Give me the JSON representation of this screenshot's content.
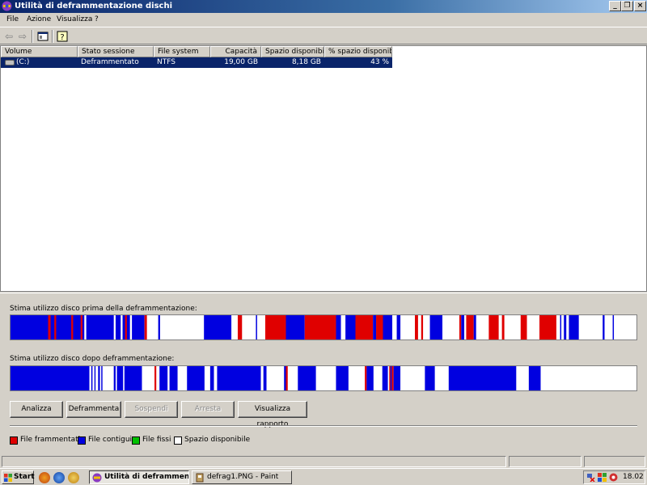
{
  "window": {
    "title": "Utilità di deframmentazione dischi",
    "controls": {
      "minimize": "_",
      "restore": "❐",
      "close": "×"
    }
  },
  "menu": [
    "File",
    "Azione",
    "Visualizza",
    "?"
  ],
  "toolbar": {
    "icons": [
      "back-arrow-icon",
      "forward-arrow-icon",
      "console-tree-icon",
      "help-icon"
    ]
  },
  "volume_list": {
    "columns": [
      "Volume",
      "Stato sessione",
      "File system",
      "Capacità",
      "Spazio disponibile",
      "% spazio disponibile"
    ],
    "rows": [
      {
        "volume": "(C:)",
        "status": "Deframmentato",
        "fs": "NTFS",
        "capacity": "19,00 GB",
        "free": "8,18 GB",
        "free_pct": "43 %"
      }
    ]
  },
  "maps": {
    "before_label": "Stima utilizzo disco prima della deframmentazione:",
    "after_label": "Stima utilizzo disco dopo deframmentazione:"
  },
  "buttons": {
    "analyze": "Analizza",
    "defrag": "Deframmenta",
    "pause": "Sospendi",
    "stop": "Arresta",
    "report": "Visualizza rapporto"
  },
  "legend": [
    {
      "label": "File frammentati",
      "color": "#e00000"
    },
    {
      "label": "File contigui",
      "color": "#0000e0"
    },
    {
      "label": "File fissi",
      "color": "#00c000"
    },
    {
      "label": "Spazio disponibile",
      "color": "#ffffff"
    }
  ],
  "colors": {
    "fragmented": "#e00000",
    "contiguous": "#0000e0",
    "free": "#ffffff",
    "selection": "#0a246a"
  },
  "taskbar": {
    "start": "Start",
    "tasks": [
      {
        "label": "Utilità di deframment...",
        "active": true
      },
      {
        "label": "defrag1.PNG - Paint",
        "active": false
      }
    ],
    "clock": "18.02"
  },
  "disk_map": {
    "before": [
      [
        "b",
        0.0,
        0.118
      ],
      [
        "f",
        0.06,
        0.064
      ],
      [
        "f",
        0.07,
        0.073
      ],
      [
        "f",
        0.097,
        0.1
      ],
      [
        "f",
        0.112,
        0.115
      ],
      [
        "w",
        0.118,
        0.121
      ],
      [
        "b",
        0.121,
        0.191
      ],
      [
        "w",
        0.165,
        0.168
      ],
      [
        "w",
        0.176,
        0.179
      ],
      [
        "f",
        0.183,
        0.186
      ],
      [
        "w",
        0.191,
        0.194
      ],
      [
        "b",
        0.194,
        0.214
      ],
      [
        "f",
        0.214,
        0.218
      ],
      [
        "w",
        0.218,
        0.234
      ],
      [
        "w",
        0.234,
        0.236
      ],
      [
        "b",
        0.236,
        0.239
      ],
      [
        "w",
        0.239,
        0.309
      ],
      [
        "b",
        0.309,
        0.353
      ],
      [
        "w",
        0.353,
        0.363
      ],
      [
        "f",
        0.363,
        0.37
      ],
      [
        "w",
        0.37,
        0.392
      ],
      [
        "b",
        0.392,
        0.394
      ],
      [
        "w",
        0.394,
        0.407
      ],
      [
        "f",
        0.407,
        0.44
      ],
      [
        "w",
        0.44,
        0.44
      ],
      [
        "b",
        0.44,
        0.47
      ],
      [
        "f",
        0.47,
        0.52
      ],
      [
        "b",
        0.52,
        0.528
      ],
      [
        "w",
        0.528,
        0.535
      ],
      [
        "b",
        0.535,
        0.551
      ],
      [
        "f",
        0.551,
        0.579
      ],
      [
        "b",
        0.579,
        0.584
      ],
      [
        "f",
        0.584,
        0.595
      ],
      [
        "b",
        0.595,
        0.61
      ],
      [
        "w",
        0.61,
        0.617
      ],
      [
        "b",
        0.617,
        0.623
      ],
      [
        "w",
        0.623,
        0.646
      ],
      [
        "f",
        0.646,
        0.651
      ],
      [
        "f",
        0.656,
        0.659
      ],
      [
        "b",
        0.67,
        0.69
      ],
      [
        "w",
        0.69,
        0.717
      ],
      [
        "f",
        0.717,
        0.72
      ],
      [
        "b",
        0.72,
        0.725
      ],
      [
        "w",
        0.725,
        0.728
      ],
      [
        "f",
        0.728,
        0.74
      ],
      [
        "b",
        0.74,
        0.744
      ],
      [
        "w",
        0.744,
        0.764
      ],
      [
        "f",
        0.764,
        0.78
      ],
      [
        "w",
        0.78,
        0.785
      ],
      [
        "f",
        0.785,
        0.789
      ],
      [
        "w",
        0.789,
        0.815
      ],
      [
        "f",
        0.815,
        0.825
      ],
      [
        "w",
        0.825,
        0.845
      ],
      [
        "f",
        0.845,
        0.872
      ],
      [
        "w",
        0.872,
        0.878
      ],
      [
        "b",
        0.878,
        0.88
      ],
      [
        "w",
        0.88,
        0.884
      ],
      [
        "b",
        0.884,
        0.888
      ],
      [
        "w",
        0.888,
        0.892
      ],
      [
        "b",
        0.892,
        0.908
      ],
      [
        "w",
        0.908,
        0.946
      ],
      [
        "b",
        0.946,
        0.949
      ],
      [
        "w",
        0.949,
        0.962
      ],
      [
        "b",
        0.962,
        0.964
      ],
      [
        "w",
        0.964,
        1.0
      ]
    ],
    "after": [
      [
        "b",
        0.0,
        0.126
      ],
      [
        "w",
        0.126,
        0.129
      ],
      [
        "b",
        0.129,
        0.131
      ],
      [
        "w",
        0.131,
        0.134
      ],
      [
        "b",
        0.134,
        0.136
      ],
      [
        "w",
        0.136,
        0.14
      ],
      [
        "b",
        0.14,
        0.143
      ],
      [
        "w",
        0.143,
        0.145
      ],
      [
        "b",
        0.145,
        0.147
      ],
      [
        "w",
        0.147,
        0.165
      ],
      [
        "b",
        0.165,
        0.168
      ],
      [
        "w",
        0.168,
        0.17
      ],
      [
        "b",
        0.17,
        0.18
      ],
      [
        "w",
        0.18,
        0.182
      ],
      [
        "b",
        0.182,
        0.21
      ],
      [
        "w",
        0.21,
        0.23
      ],
      [
        "f",
        0.23,
        0.233
      ],
      [
        "w",
        0.233,
        0.238
      ],
      [
        "b",
        0.238,
        0.251
      ],
      [
        "w",
        0.251,
        0.254
      ],
      [
        "b",
        0.254,
        0.267
      ],
      [
        "w",
        0.267,
        0.282
      ],
      [
        "b",
        0.282,
        0.31
      ],
      [
        "w",
        0.31,
        0.319
      ],
      [
        "b",
        0.319,
        0.325
      ],
      [
        "w",
        0.325,
        0.33
      ],
      [
        "b",
        0.33,
        0.4
      ],
      [
        "w",
        0.4,
        0.404
      ],
      [
        "b",
        0.404,
        0.409
      ],
      [
        "w",
        0.409,
        0.437
      ],
      [
        "b",
        0.437,
        0.44
      ],
      [
        "f",
        0.44,
        0.443
      ],
      [
        "w",
        0.443,
        0.459
      ],
      [
        "b",
        0.459,
        0.488
      ],
      [
        "w",
        0.488,
        0.52
      ],
      [
        "b",
        0.52,
        0.54
      ],
      [
        "w",
        0.54,
        0.566
      ],
      [
        "f",
        0.566,
        0.569
      ],
      [
        "b",
        0.569,
        0.58
      ],
      [
        "w",
        0.58,
        0.594
      ],
      [
        "b",
        0.594,
        0.603
      ],
      [
        "w",
        0.603,
        0.605
      ],
      [
        "f",
        0.605,
        0.607
      ],
      [
        "b",
        0.607,
        0.609
      ],
      [
        "f",
        0.609,
        0.612
      ],
      [
        "b",
        0.612,
        0.623
      ],
      [
        "w",
        0.623,
        0.662
      ],
      [
        "b",
        0.662,
        0.678
      ],
      [
        "w",
        0.678,
        0.7
      ],
      [
        "b",
        0.7,
        0.808
      ],
      [
        "w",
        0.808,
        0.828
      ],
      [
        "b",
        0.828,
        0.847
      ],
      [
        "w",
        0.847,
        1.0
      ]
    ]
  }
}
